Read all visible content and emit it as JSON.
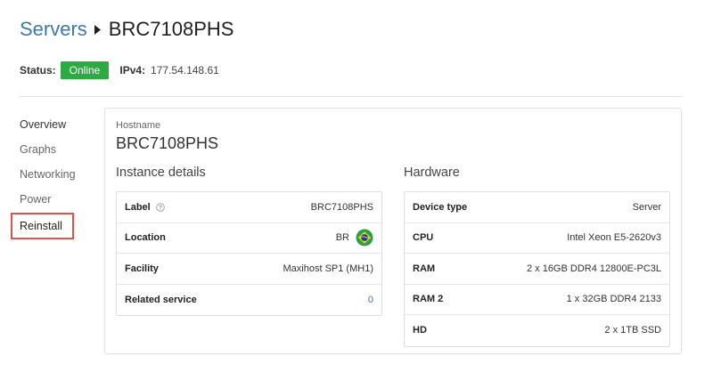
{
  "breadcrumb": {
    "parent": "Servers",
    "current": "BRC7108PHS"
  },
  "status": {
    "label": "Status:",
    "value": "Online",
    "color": "#2eaa42",
    "ipv4_label": "IPv4:",
    "ipv4_value": "177.54.148.61"
  },
  "sidenav": {
    "items": [
      {
        "label": "Overview"
      },
      {
        "label": "Graphs"
      },
      {
        "label": "Networking"
      },
      {
        "label": "Power"
      },
      {
        "label": "Reinstall",
        "active": true
      }
    ]
  },
  "main": {
    "hostname_label": "Hostname",
    "hostname_value": "BRC7108PHS",
    "instance_details": {
      "title": "Instance details",
      "rows": [
        {
          "key": "Label",
          "value": "BRC7108PHS",
          "icon": "info-icon"
        },
        {
          "key": "Location",
          "value": "BR",
          "icon": "brazil-flag-icon"
        },
        {
          "key": "Facility",
          "value": "Maxihost SP1 (MH1)"
        },
        {
          "key": "Related service",
          "value": "0"
        }
      ]
    },
    "hardware": {
      "title": "Hardware",
      "rows": [
        {
          "key": "Device type",
          "value": "Server"
        },
        {
          "key": "CPU",
          "value": "Intel Xeon E5-2620v3"
        },
        {
          "key": "RAM",
          "value": "2 x 16GB DDR4 12800E-PC3L"
        },
        {
          "key": "RAM 2",
          "value": "1 x 32GB DDR4 2133"
        },
        {
          "key": "HD",
          "value": "2 x 1TB SSD"
        }
      ]
    }
  },
  "colors": {
    "link": "#3a78b8",
    "highlight_border": "#d9534f"
  }
}
